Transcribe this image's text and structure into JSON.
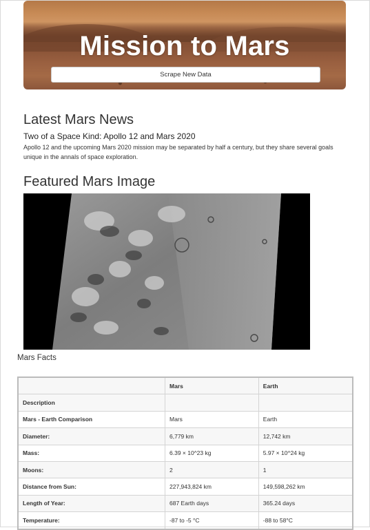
{
  "header": {
    "title": "Mission to Mars",
    "scrape_button": "Scrape New Data"
  },
  "news": {
    "section_title": "Latest Mars News",
    "title": "Two of a Space Kind: Apollo 12 and Mars 2020",
    "teaser": "Apollo 12 and the upcoming Mars 2020 mission may be separated by half a century, but they share several goals unique in the annals of space exploration."
  },
  "featured": {
    "section_title": "Featured Mars Image"
  },
  "facts": {
    "section_title": "Mars Facts",
    "columns": [
      "",
      "Mars",
      "Earth"
    ],
    "rows": [
      [
        "Description",
        "",
        ""
      ],
      [
        "Mars - Earth Comparison",
        "Mars",
        "Earth"
      ],
      [
        "Diameter:",
        "6,779 km",
        "12,742 km"
      ],
      [
        "Mass:",
        "6.39 × 10^23 kg",
        "5.97 × 10^24 kg"
      ],
      [
        "Moons:",
        "2",
        "1"
      ],
      [
        "Distance from Sun:",
        "227,943,824 km",
        "149,598,262 km"
      ],
      [
        "Length of Year:",
        "687 Earth days",
        "365.24 days"
      ],
      [
        "Temperature:",
        "-87 to -5 °C",
        "-88 to 58°C"
      ]
    ]
  }
}
